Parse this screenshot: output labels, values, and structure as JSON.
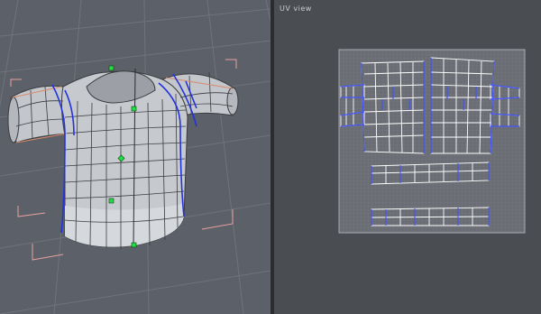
{
  "uv_view": {
    "title": "UV view"
  },
  "colors": {
    "viewport_bg": "#5c6068",
    "uv_bg": "#4a4d52",
    "mesh_fill": "#c6c9ce",
    "mesh_edge": "#3a3c40",
    "seam": "#2233dd",
    "handle": "#22dd44",
    "bracket": "#e8a0a0",
    "uv_island": "#ffffff"
  },
  "icons": [
    "move-handle-icon",
    "corner-bracket-icon"
  ]
}
